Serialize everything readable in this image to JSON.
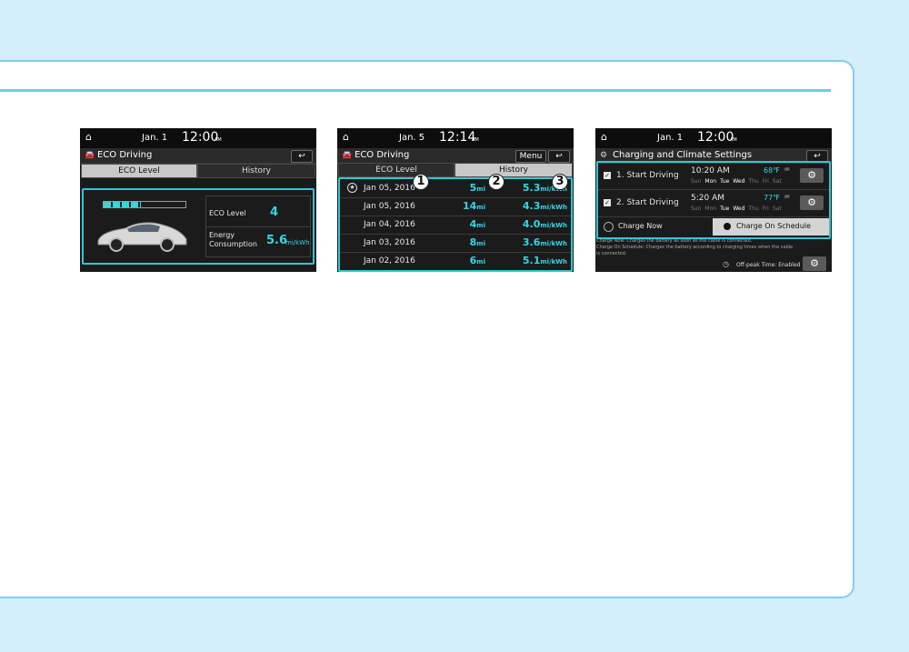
{
  "screen1": {
    "date": "Jan.  1",
    "time": "12:00",
    "ampm": "AM",
    "title": "ECO Driving",
    "back_icon": "back-arrow-icon",
    "tabs": [
      "ECO Level",
      "History"
    ],
    "eco_bar_level": 0.45,
    "eco_level_label": "ECO Level",
    "eco_level_value": "4",
    "energy_label_1": "Energy",
    "energy_label_2": "Consumption",
    "energy_value": "5.6",
    "energy_unit": "mi/kWh"
  },
  "screen2": {
    "date": "Jan.  5",
    "time": "12:14",
    "ampm": "AM",
    "title": "ECO Driving",
    "menu_label": "Menu",
    "tabs": [
      "ECO Level",
      "History"
    ],
    "rows": [
      {
        "date": "Jan 05, 2016",
        "dist": "5",
        "dist_unit": "mi",
        "eff": "5.3",
        "eff_unit": "mi/kWh"
      },
      {
        "date": "Jan 05, 2016",
        "dist": "14",
        "dist_unit": "mi",
        "eff": "4.3",
        "eff_unit": "mi/kWh"
      },
      {
        "date": "Jan 04, 2016",
        "dist": "4",
        "dist_unit": "mi",
        "eff": "4.0",
        "eff_unit": "mi/kWh"
      },
      {
        "date": "Jan 03, 2016",
        "dist": "8",
        "dist_unit": "mi",
        "eff": "3.6",
        "eff_unit": "mi/kWh"
      },
      {
        "date": "Jan 02, 2016",
        "dist": "6",
        "dist_unit": "mi",
        "eff": "5.1",
        "eff_unit": "mi/kWh"
      }
    ],
    "callouts": [
      "1",
      "2",
      "3"
    ]
  },
  "screen3": {
    "date": "Jan.  1",
    "time": "12:00",
    "ampm": "AM",
    "title": "Charging and Climate Settings",
    "schedules": [
      {
        "label": "1. Start Driving",
        "time": "10:20 AM",
        "temp": "68℉",
        "days": [
          "Sun",
          "Mon",
          "Tue",
          "Wed",
          "Thu",
          "Fri",
          "Sat"
        ],
        "active_days": [
          1,
          2,
          3
        ]
      },
      {
        "label": "2. Start Driving",
        "time": "5:20 AM",
        "temp": "77℉",
        "days": [
          "Sun",
          "Mon",
          "Tue",
          "Wed",
          "Thu",
          "Fri",
          "Sat"
        ],
        "active_days": [
          2,
          3
        ]
      }
    ],
    "charge_now": "Charge Now",
    "charge_schedule": "Charge On Schedule",
    "note1": "Charge Now: Charges the battery as soon as the cable is connected.",
    "note2": "Charge On Schedule: Charges the battery according to charging times when the cable",
    "note3": "is connected.",
    "offpeak": "Off-peak Time: Enabled"
  },
  "colors": {
    "accent": "#2fc8d6",
    "rule": "#74c9ec",
    "bg": "#d5eefb"
  }
}
